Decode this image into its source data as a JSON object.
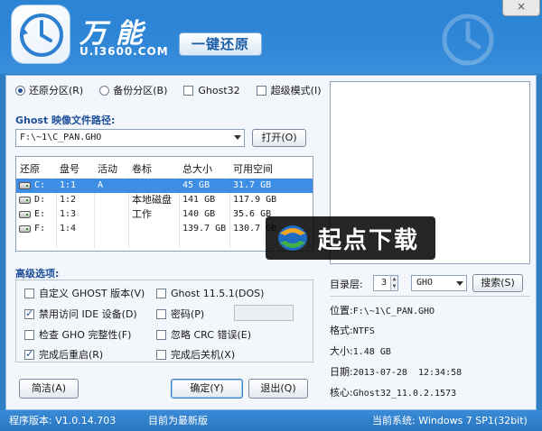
{
  "header": {
    "brand": "万能",
    "url": "U.I3600.COM",
    "slogan": "一键还原",
    "close": "×"
  },
  "mode": {
    "restore": "还原分区(R)",
    "backup": "备份分区(B)",
    "ghost32": "Ghost32",
    "super": "超级模式(I)",
    "selected": "restore"
  },
  "path": {
    "label": "Ghost 映像文件路径:",
    "value": "F:\\~1\\C_PAN.GHO",
    "open_button": "打开(O)"
  },
  "table": {
    "headers": [
      "还原",
      "盘号",
      "活动",
      "卷标",
      "总大小",
      "可用空间"
    ],
    "rows": [
      {
        "drive": "C:",
        "num": "1:1",
        "active": "A",
        "label": "",
        "total": "45 GB",
        "free": "31.7 GB",
        "selected": true
      },
      {
        "drive": "D:",
        "num": "1:2",
        "active": "",
        "label": "本地磁盘",
        "total": "141 GB",
        "free": "117.9 GB",
        "selected": false
      },
      {
        "drive": "E:",
        "num": "1:3",
        "active": "",
        "label": "工作",
        "total": "140 GB",
        "free": "35.6 GB",
        "selected": false
      },
      {
        "drive": "F:",
        "num": "1:4",
        "active": "",
        "label": "",
        "total": "139.7 GB",
        "free": "130.7 GB",
        "selected": false
      }
    ]
  },
  "advanced": {
    "title": "高级选项:",
    "custom_ghost": "自定义 GHOST 版本(V)",
    "ghost_version": "Ghost 11.5.1(DOS)",
    "disable_ide": "禁用访问 IDE 设备(D)",
    "password": "密码(P)",
    "check_gho": "检查 GHO 完整性(F)",
    "ignore_crc": "忽略 CRC 错误(E)",
    "reboot": "完成后重启(R)",
    "shutdown": "完成后关机(X)",
    "checked": {
      "custom_ghost": false,
      "ghost_version": false,
      "disable_ide": true,
      "password": false,
      "check_gho": false,
      "ignore_crc": false,
      "reboot": true,
      "shutdown": false
    }
  },
  "buttons": {
    "simple": "简洁(A)",
    "ok": "确定(Y)",
    "exit": "退出(Q)",
    "search": "搜索(S)"
  },
  "dir": {
    "label": "目录层:",
    "level": "3",
    "ext": "GHO"
  },
  "info": {
    "location_k": "位置:",
    "location_v": "F:\\~1\\C_PAN.GHO",
    "format_k": "格式:",
    "format_v": "NTFS",
    "size_k": "大小:",
    "size_v": "1.48 GB",
    "date_k": "日期:",
    "date_v": "2013-07-28  12:34:58",
    "core_k": "核心:",
    "core_v": "Ghost32_11.0.2.1573"
  },
  "watermark": {
    "text": "起点下载"
  },
  "status": {
    "version": "程序版本: V1.0.14.703",
    "latest": "目前为最新版",
    "system": "当前系统: Windows 7 SP1(32bit)"
  },
  "colors": {
    "accent": "#2f86d6",
    "selection": "#3e8ee6",
    "label_blue": "#1d4f9a"
  }
}
